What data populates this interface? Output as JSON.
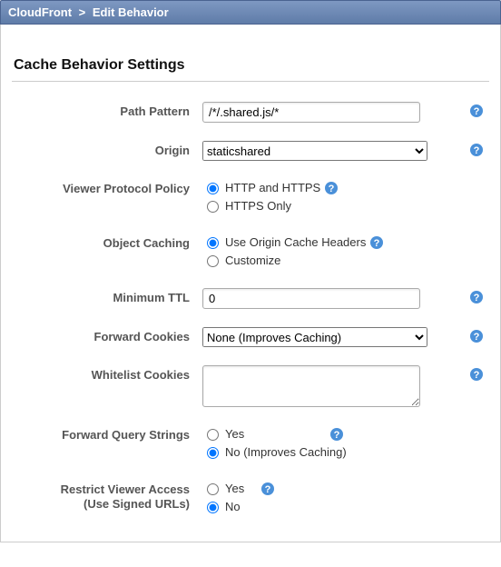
{
  "breadcrumb": {
    "root": "CloudFront",
    "sep": ">",
    "current": "Edit Behavior"
  },
  "section_title": "Cache Behavior Settings",
  "labels": {
    "path_pattern": "Path Pattern",
    "origin": "Origin",
    "viewer_protocol": "Viewer Protocol Policy",
    "object_caching": "Object Caching",
    "min_ttl": "Minimum TTL",
    "fwd_cookies": "Forward Cookies",
    "whitelist_cookies": "Whitelist Cookies",
    "fwd_query": "Forward Query Strings",
    "restrict_access_l1": "Restrict Viewer Access",
    "restrict_access_l2": "(Use Signed URLs)"
  },
  "values": {
    "path_pattern": "/*/.shared.js/*",
    "origin_selected": "staticshared",
    "min_ttl": "0",
    "fwd_cookies_selected": "None (Improves Caching)",
    "whitelist_cookies": ""
  },
  "options": {
    "viewer_protocol": [
      {
        "label": "HTTP and HTTPS",
        "checked": true,
        "help": true
      },
      {
        "label": "HTTPS Only",
        "checked": false,
        "help": false
      }
    ],
    "object_caching": [
      {
        "label": "Use Origin Cache Headers",
        "checked": true,
        "help": true
      },
      {
        "label": "Customize",
        "checked": false,
        "help": false
      }
    ],
    "fwd_query": [
      {
        "label": "Yes",
        "checked": false,
        "help": true
      },
      {
        "label": "No (Improves Caching)",
        "checked": true,
        "help": false
      }
    ],
    "restrict_access": [
      {
        "label": "Yes",
        "checked": false,
        "help": true
      },
      {
        "label": "No",
        "checked": true,
        "help": false
      }
    ]
  }
}
